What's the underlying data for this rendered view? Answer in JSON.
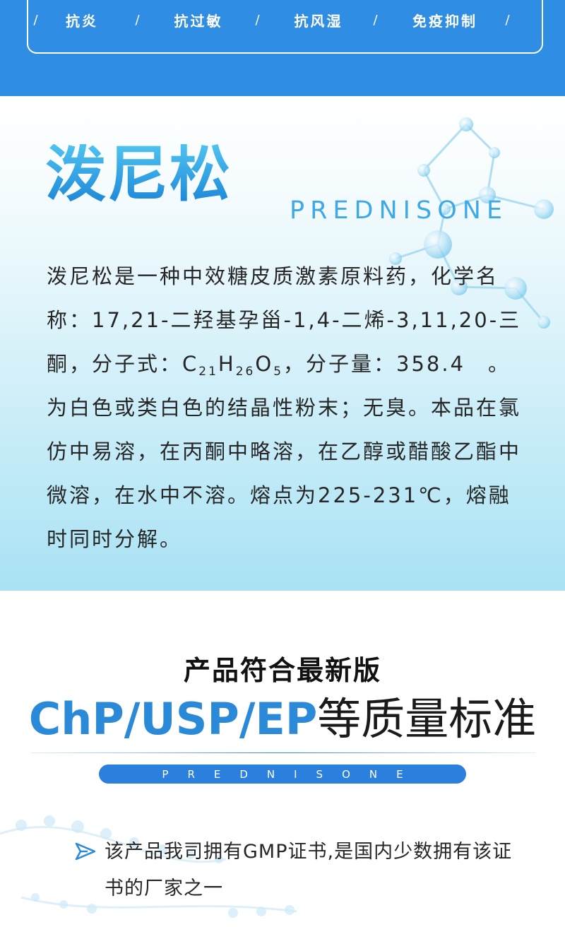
{
  "banner": {
    "tags": [
      "抗炎",
      "抗过敏",
      "抗风湿",
      "免疫抑制"
    ],
    "separator": "/"
  },
  "intro": {
    "title": "泼尼松",
    "subtitle": "PREDNISONE",
    "desc_part1": "泼尼松是一种中效糖皮质激素原料药，化学名称：17,21-二羟基孕甾-1,4-二烯-3,11,20-三酮，分子式：",
    "formula": [
      {
        "el": "C",
        "n": "21"
      },
      {
        "el": "H",
        "n": "26"
      },
      {
        "el": "O",
        "n": "5"
      }
    ],
    "desc_part2": "，分子量：358.4　。为白色或类白色的结晶性粉末；无臭。本品在氯仿中易溶，在丙酮中略溶，在乙醇或醋酸乙酯中微溶，在水中不溶。熔点为225-231℃，熔融时同时分解。"
  },
  "standards": {
    "heading": "产品符合最新版",
    "accent": "ChP/USP/EP",
    "rest": "等质量标准",
    "pill": "PREDNISONE",
    "cert": "该产品我司拥有GMP证书,是国内少数拥有该证书的厂家之一"
  },
  "colors": {
    "brand_blue": "#2f8de4",
    "accent_blue": "#2b8ad8",
    "title_light": "#4fc3f0"
  }
}
